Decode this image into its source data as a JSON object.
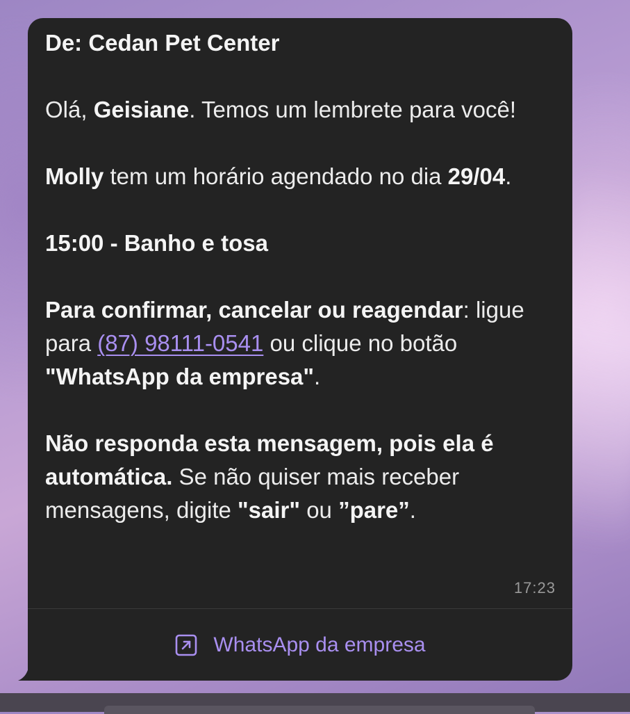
{
  "message": {
    "from_line": "De: Cedan Pet Center",
    "greeting_prefix": "Olá, ",
    "customer_name": "Geisiane",
    "greeting_suffix": ". Temos um lembrete para você!",
    "pet_name": "Molly",
    "appointment_text": " tem um horário agendado no dia ",
    "appointment_date": "29/04",
    "appointment_date_suffix": ".",
    "service_line": "15:00 - Banho e tosa",
    "instructions_bold": "Para confirmar, cancelar ou reagendar",
    "instructions_colon": ":",
    "instructions_call": " ligue para ",
    "phone_number": "(87) 98111-0541",
    "instructions_click": " ou clique no botão ",
    "instructions_button_name": "\"WhatsApp da empresa\"",
    "instructions_end": ".",
    "auto_notice_bold": "Não responda esta mensagem, pois ela é automática.",
    "auto_notice_text": " Se não quiser mais receber mensagens, digite ",
    "stop_word_1": "\"sair\"",
    "or_text": " ou ",
    "stop_word_2": "”pare”",
    "auto_notice_end": ".",
    "timestamp": "17:23"
  },
  "action_button": {
    "label": "WhatsApp da empresa",
    "icon": "external-link-icon"
  },
  "colors": {
    "bubble_background": "#232323",
    "text": "#ececec",
    "accent": "#a98ff0",
    "timestamp": "#9a9a9a"
  }
}
